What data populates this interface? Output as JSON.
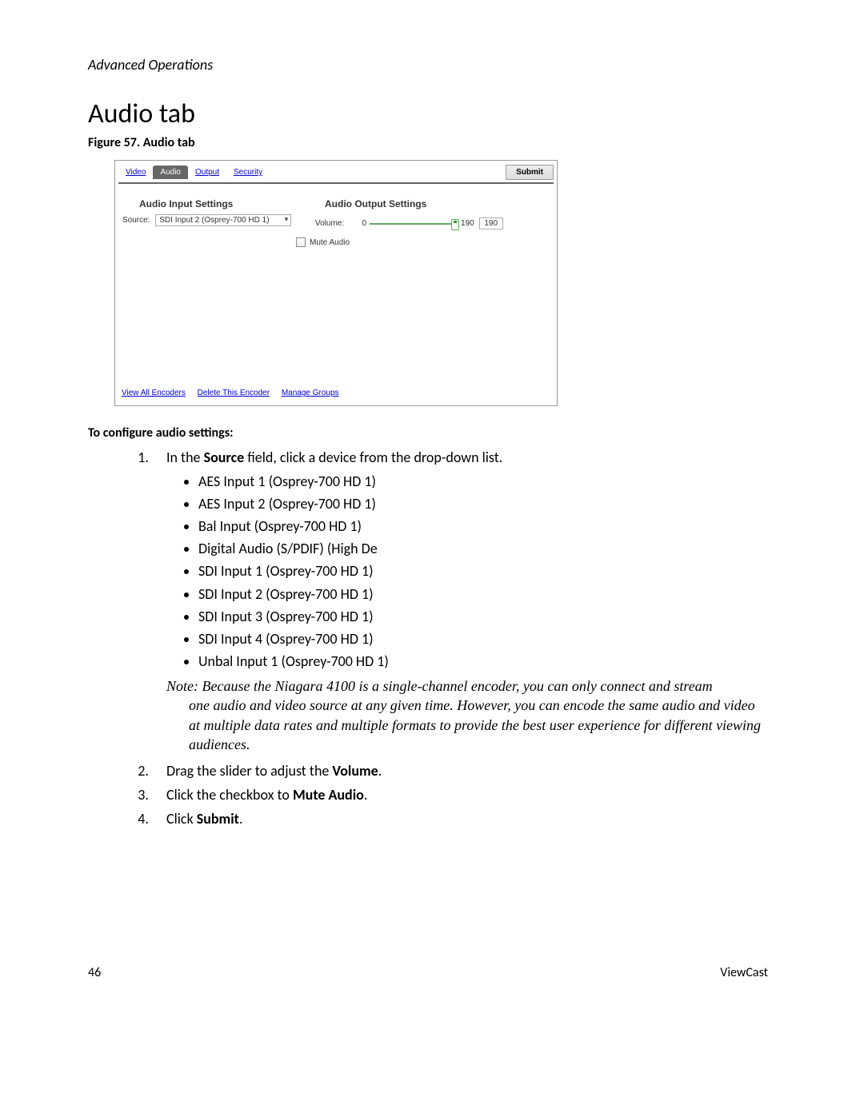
{
  "header": "Advanced Operations",
  "title": "Audio tab",
  "figure_caption": "Figure 57. Audio tab",
  "screenshot": {
    "tabs": {
      "video": "Video",
      "audio": "Audio",
      "output": "Output",
      "security": "Security"
    },
    "submit": "Submit",
    "input_heading": "Audio Input Settings",
    "source_label": "Source:",
    "source_value": "SDI Input 2 (Osprey-700 HD 1)",
    "output_heading": "Audio Output Settings",
    "volume_label": "Volume:",
    "volume_min": "0",
    "volume_max": "190",
    "volume_value": "190",
    "mute_label": "Mute Audio",
    "links": {
      "view_all": "View All Encoders",
      "delete": "Delete This Encoder",
      "manage": "Manage Groups"
    }
  },
  "instr_heading": "To configure audio settings:",
  "step1_pre": "In the ",
  "step1_bold": "Source",
  "step1_post": " field, click a device from the drop-down list.",
  "sources": [
    "AES Input 1 (Osprey-700 HD 1)",
    "AES Input 2 (Osprey-700 HD 1)",
    "Bal Input (Osprey-700 HD 1)",
    "Digital Audio (S/PDIF) (High De",
    "SDI Input 1 (Osprey-700 HD 1)",
    "SDI Input 2 (Osprey-700 HD 1)",
    "SDI Input 3 (Osprey-700 HD 1)",
    "SDI Input 4 (Osprey-700 HD 1)",
    "Unbal Input 1 (Osprey-700 HD 1)"
  ],
  "note_lead": "Note: Because the Niagara 4100 is a single-channel encoder, you can only connect and stream ",
  "note_rest": "one audio and video source at any given time. However, you can encode the same audio and video at multiple data rates and multiple formats to provide the best user experience for different viewing audiences.",
  "step2_pre": "Drag the slider to adjust the ",
  "step2_bold": "Volume",
  "step3_pre": "Click the checkbox to ",
  "step3_bold": "Mute Audio",
  "step4_pre": "Click ",
  "step4_bold": "Submit",
  "period": ".",
  "footer": {
    "page": "46",
    "brand": "ViewCast"
  }
}
